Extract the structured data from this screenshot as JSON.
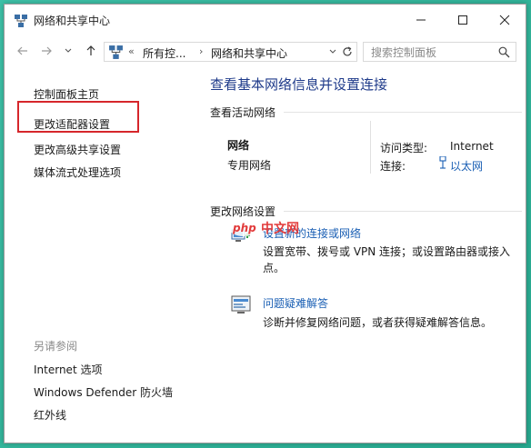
{
  "window": {
    "title": "网络和共享中心"
  },
  "address": {
    "overflow": "«",
    "crumbs": [
      "所有控...",
      "网络和共享中心"
    ],
    "sep": "›"
  },
  "search": {
    "placeholder": "搜索控制面板"
  },
  "sidebar": {
    "items": [
      {
        "label": "控制面板主页"
      },
      {
        "label": "更改适配器设置"
      },
      {
        "label": "更改高级共享设置"
      },
      {
        "label": "媒体流式处理选项"
      }
    ],
    "see_also_title": "另请参阅",
    "see_also": [
      {
        "label": "Internet 选项"
      },
      {
        "label": "Windows Defender 防火墙"
      },
      {
        "label": "红外线"
      }
    ]
  },
  "main": {
    "title": "查看基本网络信息并设置连接",
    "active_networks_label": "查看活动网络",
    "network": {
      "name": "网络",
      "type": "专用网络",
      "access_type_label": "访问类型:",
      "access_type_value": "Internet",
      "connection_label": "连接:",
      "connection_value": "以太网"
    },
    "change_settings_label": "更改网络设置",
    "tasks": [
      {
        "link": "设置新的连接或网络",
        "desc": "设置宽带、拨号或 VPN 连接；或设置路由器或接入点。"
      },
      {
        "link": "问题疑难解答",
        "desc": "诊断并修复网络问题，或者获得疑难解答信息。"
      }
    ]
  },
  "watermark": {
    "brand": "php",
    "text": "中文网"
  },
  "colors": {
    "link": "#1a5fb4",
    "title": "#1e3a8a",
    "highlight": "#d6262b",
    "background": "#2fb39a"
  }
}
